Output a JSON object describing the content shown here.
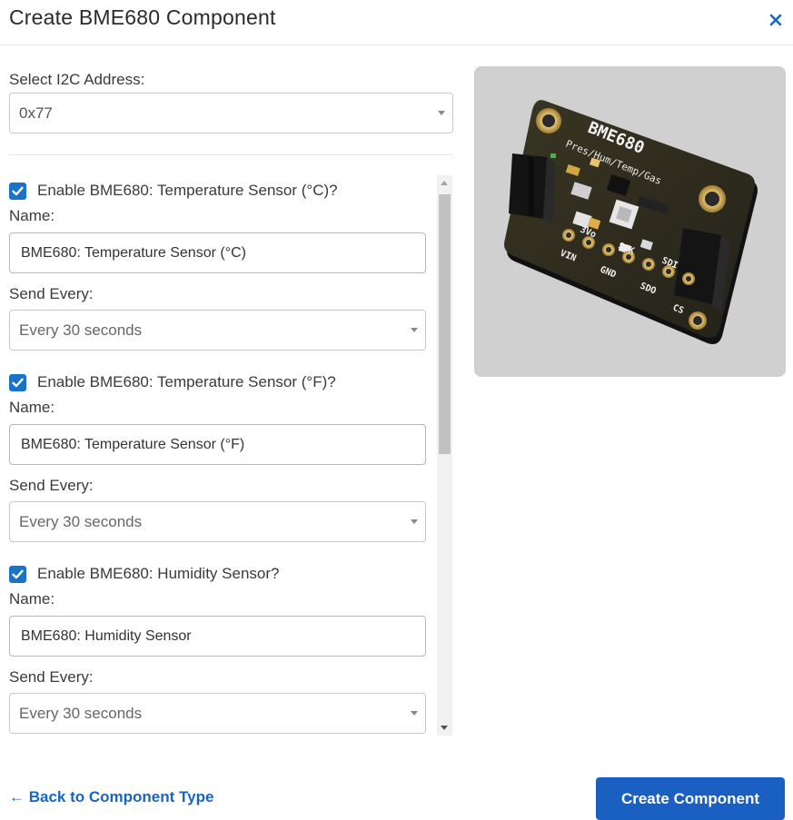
{
  "dialog": {
    "title": "Create BME680 Component",
    "close_icon": "close-icon"
  },
  "i2c": {
    "label": "Select I2C Address:",
    "value": "0x77"
  },
  "sections": [
    {
      "enable_label": "Enable BME680: Temperature Sensor (°C)?",
      "checked": true,
      "name_label": "Name:",
      "name_value": "BME680: Temperature Sensor (°C)",
      "send_label": "Send Every:",
      "send_value": "Every 30 seconds"
    },
    {
      "enable_label": "Enable BME680: Temperature Sensor (°F)?",
      "checked": true,
      "name_label": "Name:",
      "name_value": "BME680: Temperature Sensor (°F)",
      "send_label": "Send Every:",
      "send_value": "Every 30 seconds"
    },
    {
      "enable_label": "Enable BME680: Humidity Sensor?",
      "checked": true,
      "name_label": "Name:",
      "name_value": "BME680: Humidity Sensor",
      "send_label": "Send Every:",
      "send_value": "Every 30 seconds"
    }
  ],
  "board": {
    "silkscreen_title": "BME680",
    "silkscreen_subtitle": "Pres/Hum/Temp/Gas",
    "pins": [
      "VIN",
      "3Vo",
      "GND",
      "SCK",
      "SDO",
      "SDI",
      "CS"
    ]
  },
  "footer": {
    "back_label": "← Back to Component Type",
    "create_label": "Create Component"
  },
  "colors": {
    "accent": "#1a5fc2",
    "checkbox": "#1a73c8",
    "link": "#1a65c0"
  }
}
